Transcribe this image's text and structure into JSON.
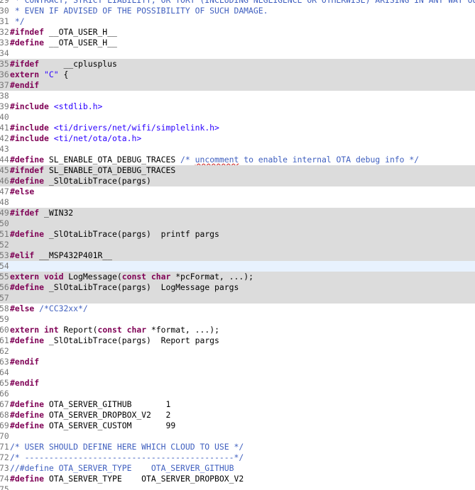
{
  "colors": {
    "background": "#ffffff",
    "line_number": "#787878",
    "keyword": "#7f0055",
    "comment": "#3f5fbf",
    "string": "#2a00ff",
    "inactive_block_bg": "#dcdcdc",
    "current_line_bg": "#e8f2fe",
    "spell_underline": "#d0312d"
  },
  "editor": {
    "lines": [
      {
        "n": "29",
        "hl": "",
        "tokens": [
          {
            "t": " * CONTRACT, STRICT LIABILITY, OR TORT (INCLUDING NEGLIGENCE OR OTHERWISE) ARISING IN ANY WAY OUT OF THE USE OF THIS SOFTWARE,",
            "c": "cm"
          }
        ]
      },
      {
        "n": "30",
        "hl": "",
        "tokens": [
          {
            "t": " * EVEN IF ADVISED OF THE POSSIBILITY OF SUCH DAMAGE.",
            "c": "cm"
          }
        ]
      },
      {
        "n": "31",
        "hl": "",
        "tokens": [
          {
            "t": " */",
            "c": "cm"
          }
        ]
      },
      {
        "n": "32",
        "hl": "",
        "tokens": [
          {
            "t": "#ifndef",
            "c": "kw"
          },
          {
            "t": " __OTA_USER_H__",
            "c": ""
          }
        ]
      },
      {
        "n": "33",
        "hl": "",
        "tokens": [
          {
            "t": "#define",
            "c": "kw"
          },
          {
            "t": " __OTA_USER_H__",
            "c": ""
          }
        ]
      },
      {
        "n": "34",
        "hl": "",
        "tokens": []
      },
      {
        "n": "35",
        "hl": "gray",
        "tokens": [
          {
            "t": "#ifdef",
            "c": "kw"
          },
          {
            "t": "     __cplusplus",
            "c": ""
          }
        ]
      },
      {
        "n": "36",
        "hl": "gray",
        "tokens": [
          {
            "t": "extern",
            "c": "kw"
          },
          {
            "t": " ",
            "c": ""
          },
          {
            "t": "\"C\"",
            "c": "st"
          },
          {
            "t": " {",
            "c": ""
          }
        ]
      },
      {
        "n": "37",
        "hl": "gray",
        "tokens": [
          {
            "t": "#endif",
            "c": "kw"
          }
        ]
      },
      {
        "n": "38",
        "hl": "",
        "tokens": []
      },
      {
        "n": "39",
        "hl": "",
        "tokens": [
          {
            "t": "#include",
            "c": "kw"
          },
          {
            "t": " ",
            "c": ""
          },
          {
            "t": "<stdlib.h>",
            "c": "st"
          }
        ]
      },
      {
        "n": "40",
        "hl": "",
        "tokens": []
      },
      {
        "n": "41",
        "hl": "",
        "tokens": [
          {
            "t": "#include",
            "c": "kw"
          },
          {
            "t": " ",
            "c": ""
          },
          {
            "t": "<ti/drivers/net/wifi/simplelink.h>",
            "c": "st"
          }
        ]
      },
      {
        "n": "42",
        "hl": "",
        "tokens": [
          {
            "t": "#include",
            "c": "kw"
          },
          {
            "t": " ",
            "c": ""
          },
          {
            "t": "<ti/net/ota/ota.h>",
            "c": "st"
          }
        ]
      },
      {
        "n": "43",
        "hl": "",
        "tokens": []
      },
      {
        "n": "44",
        "hl": "",
        "tokens": [
          {
            "t": "#define",
            "c": "kw"
          },
          {
            "t": " SL_ENABLE_OTA_DEBUG_TRACES ",
            "c": ""
          },
          {
            "t": "/* ",
            "c": "cm"
          },
          {
            "t": "uncomment",
            "c": "cm spell"
          },
          {
            "t": " to enable internal OTA debug info */",
            "c": "cm"
          }
        ]
      },
      {
        "n": "45",
        "hl": "gray",
        "tokens": [
          {
            "t": "#ifndef",
            "c": "kw"
          },
          {
            "t": " SL_ENABLE_OTA_DEBUG_TRACES",
            "c": ""
          }
        ]
      },
      {
        "n": "46",
        "hl": "gray",
        "tokens": [
          {
            "t": "#define",
            "c": "kw"
          },
          {
            "t": " _SlOtaLibTrace(pargs)",
            "c": ""
          }
        ]
      },
      {
        "n": "47",
        "hl": "",
        "tokens": [
          {
            "t": "#else",
            "c": "kw"
          }
        ]
      },
      {
        "n": "48",
        "hl": "",
        "tokens": []
      },
      {
        "n": "49",
        "hl": "gray",
        "tokens": [
          {
            "t": "#ifdef",
            "c": "kw"
          },
          {
            "t": " _WIN32",
            "c": ""
          }
        ]
      },
      {
        "n": "50",
        "hl": "gray",
        "tokens": []
      },
      {
        "n": "51",
        "hl": "gray",
        "tokens": [
          {
            "t": "#define",
            "c": "kw"
          },
          {
            "t": " _SlOtaLibTrace(pargs)  printf pargs",
            "c": ""
          }
        ]
      },
      {
        "n": "52",
        "hl": "gray",
        "tokens": []
      },
      {
        "n": "53",
        "hl": "gray",
        "tokens": [
          {
            "t": "#elif",
            "c": "kw"
          },
          {
            "t": " __MSP432P401R__",
            "c": ""
          }
        ]
      },
      {
        "n": "54",
        "hl": "cur",
        "tokens": []
      },
      {
        "n": "55",
        "hl": "gray",
        "tokens": [
          {
            "t": "extern",
            "c": "kw"
          },
          {
            "t": " ",
            "c": ""
          },
          {
            "t": "void",
            "c": "kw"
          },
          {
            "t": " LogMessage(",
            "c": ""
          },
          {
            "t": "const",
            "c": "kw"
          },
          {
            "t": " ",
            "c": ""
          },
          {
            "t": "char",
            "c": "kw"
          },
          {
            "t": " *pcFormat, ...);",
            "c": ""
          }
        ]
      },
      {
        "n": "56",
        "hl": "gray",
        "tokens": [
          {
            "t": "#define",
            "c": "kw"
          },
          {
            "t": " _SlOtaLibTrace(pargs)  LogMessage pargs",
            "c": ""
          }
        ]
      },
      {
        "n": "57",
        "hl": "gray",
        "tokens": []
      },
      {
        "n": "58",
        "hl": "",
        "tokens": [
          {
            "t": "#else",
            "c": "kw"
          },
          {
            "t": " ",
            "c": ""
          },
          {
            "t": "/*CC32xx*/",
            "c": "cm"
          }
        ]
      },
      {
        "n": "59",
        "hl": "",
        "tokens": []
      },
      {
        "n": "60",
        "hl": "",
        "tokens": [
          {
            "t": "extern",
            "c": "kw"
          },
          {
            "t": " ",
            "c": ""
          },
          {
            "t": "int",
            "c": "kw"
          },
          {
            "t": " Report(",
            "c": ""
          },
          {
            "t": "const",
            "c": "kw"
          },
          {
            "t": " ",
            "c": ""
          },
          {
            "t": "char",
            "c": "kw"
          },
          {
            "t": " *format, ...);",
            "c": ""
          }
        ]
      },
      {
        "n": "61",
        "hl": "",
        "tokens": [
          {
            "t": "#define",
            "c": "kw"
          },
          {
            "t": " _SlOtaLibTrace(pargs)  Report pargs",
            "c": ""
          }
        ]
      },
      {
        "n": "62",
        "hl": "",
        "tokens": []
      },
      {
        "n": "63",
        "hl": "",
        "tokens": [
          {
            "t": "#endif",
            "c": "kw"
          }
        ]
      },
      {
        "n": "64",
        "hl": "",
        "tokens": []
      },
      {
        "n": "65",
        "hl": "",
        "tokens": [
          {
            "t": "#endif",
            "c": "kw"
          }
        ]
      },
      {
        "n": "66",
        "hl": "",
        "tokens": []
      },
      {
        "n": "67",
        "hl": "",
        "tokens": [
          {
            "t": "#define",
            "c": "kw"
          },
          {
            "t": " OTA_SERVER_GITHUB       1",
            "c": ""
          }
        ]
      },
      {
        "n": "68",
        "hl": "",
        "tokens": [
          {
            "t": "#define",
            "c": "kw"
          },
          {
            "t": " OTA_SERVER_DROPBOX_V2   2",
            "c": ""
          }
        ]
      },
      {
        "n": "69",
        "hl": "",
        "tokens": [
          {
            "t": "#define",
            "c": "kw"
          },
          {
            "t": " OTA_SERVER_CUSTOM       99",
            "c": ""
          }
        ]
      },
      {
        "n": "70",
        "hl": "",
        "tokens": []
      },
      {
        "n": "71",
        "hl": "",
        "tokens": [
          {
            "t": "/* USER SHOULD DEFINE HERE WHICH CLOUD TO USE */",
            "c": "cm"
          }
        ]
      },
      {
        "n": "72",
        "hl": "",
        "tokens": [
          {
            "t": "/* -------------------------------------------*/",
            "c": "cm"
          }
        ]
      },
      {
        "n": "73",
        "hl": "",
        "tokens": [
          {
            "t": "//#define OTA_SERVER_TYPE    OTA_SERVER_GITHUB",
            "c": "cm"
          }
        ]
      },
      {
        "n": "74",
        "hl": "",
        "tokens": [
          {
            "t": "#define",
            "c": "kw"
          },
          {
            "t": " OTA_SERVER_TYPE    OTA_SERVER_DROPBOX_V2",
            "c": ""
          }
        ]
      },
      {
        "n": "75",
        "hl": "",
        "tokens": []
      }
    ]
  }
}
